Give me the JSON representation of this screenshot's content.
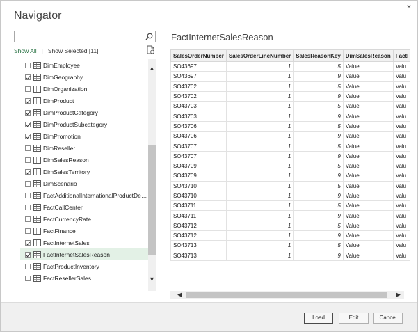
{
  "window": {
    "title": "Navigator",
    "close": "×"
  },
  "search": {
    "value": "",
    "placeholder": ""
  },
  "filter": {
    "show_all": "Show All",
    "separator": "|",
    "show_selected": "Show Selected [11]"
  },
  "tree": {
    "items": [
      {
        "label": "DimEmployee",
        "checked": false,
        "selected": false
      },
      {
        "label": "DimGeography",
        "checked": true,
        "selected": false
      },
      {
        "label": "DimOrganization",
        "checked": false,
        "selected": false
      },
      {
        "label": "DimProduct",
        "checked": true,
        "selected": false
      },
      {
        "label": "DimProductCategory",
        "checked": true,
        "selected": false
      },
      {
        "label": "DimProductSubcategory",
        "checked": true,
        "selected": false
      },
      {
        "label": "DimPromotion",
        "checked": true,
        "selected": false
      },
      {
        "label": "DimReseller",
        "checked": false,
        "selected": false
      },
      {
        "label": "DimSalesReason",
        "checked": false,
        "selected": false
      },
      {
        "label": "DimSalesTerritory",
        "checked": true,
        "selected": false
      },
      {
        "label": "DimScenario",
        "checked": false,
        "selected": false
      },
      {
        "label": "FactAdditionalInternationalProductDescr...",
        "checked": false,
        "selected": false
      },
      {
        "label": "FactCallCenter",
        "checked": false,
        "selected": false
      },
      {
        "label": "FactCurrencyRate",
        "checked": false,
        "selected": false
      },
      {
        "label": "FactFinance",
        "checked": false,
        "selected": false
      },
      {
        "label": "FactInternetSales",
        "checked": true,
        "selected": false
      },
      {
        "label": "FactInternetSalesReason",
        "checked": true,
        "selected": true
      },
      {
        "label": "FactProductInventory",
        "checked": false,
        "selected": false
      },
      {
        "label": "FactResellerSales",
        "checked": false,
        "selected": false
      }
    ]
  },
  "preview": {
    "title": "FactInternetSalesReason",
    "columns": [
      "SalesOrderNumber",
      "SalesOrderLineNumber",
      "SalesReasonKey",
      "DimSalesReason",
      "FactI"
    ],
    "rows": [
      [
        "SO43697",
        "1",
        "5",
        "Value",
        "Valu"
      ],
      [
        "SO43697",
        "1",
        "9",
        "Value",
        "Valu"
      ],
      [
        "SO43702",
        "1",
        "5",
        "Value",
        "Valu"
      ],
      [
        "SO43702",
        "1",
        "9",
        "Value",
        "Valu"
      ],
      [
        "SO43703",
        "1",
        "5",
        "Value",
        "Valu"
      ],
      [
        "SO43703",
        "1",
        "9",
        "Value",
        "Valu"
      ],
      [
        "SO43706",
        "1",
        "5",
        "Value",
        "Valu"
      ],
      [
        "SO43706",
        "1",
        "9",
        "Value",
        "Valu"
      ],
      [
        "SO43707",
        "1",
        "5",
        "Value",
        "Valu"
      ],
      [
        "SO43707",
        "1",
        "9",
        "Value",
        "Valu"
      ],
      [
        "SO43709",
        "1",
        "5",
        "Value",
        "Valu"
      ],
      [
        "SO43709",
        "1",
        "9",
        "Value",
        "Valu"
      ],
      [
        "SO43710",
        "1",
        "5",
        "Value",
        "Valu"
      ],
      [
        "SO43710",
        "1",
        "9",
        "Value",
        "Valu"
      ],
      [
        "SO43711",
        "1",
        "5",
        "Value",
        "Valu"
      ],
      [
        "SO43711",
        "1",
        "9",
        "Value",
        "Valu"
      ],
      [
        "SO43712",
        "1",
        "5",
        "Value",
        "Valu"
      ],
      [
        "SO43712",
        "1",
        "9",
        "Value",
        "Valu"
      ],
      [
        "SO43713",
        "1",
        "5",
        "Value",
        "Valu"
      ],
      [
        "SO43713",
        "1",
        "9",
        "Value",
        "Valu"
      ]
    ]
  },
  "footer": {
    "load": "Load",
    "edit": "Edit",
    "cancel": "Cancel"
  },
  "icons": {
    "search": "search-icon",
    "refresh": "refresh-document-icon",
    "table": "table-icon",
    "close": "close-icon",
    "scroll_up": "▲",
    "scroll_down": "▼",
    "scroll_left": "◀",
    "scroll_right": "▶"
  },
  "colors": {
    "accent": "#1f6b3b",
    "selected_row": "#e3f1e6",
    "header_bg": "#f1f1f1"
  }
}
